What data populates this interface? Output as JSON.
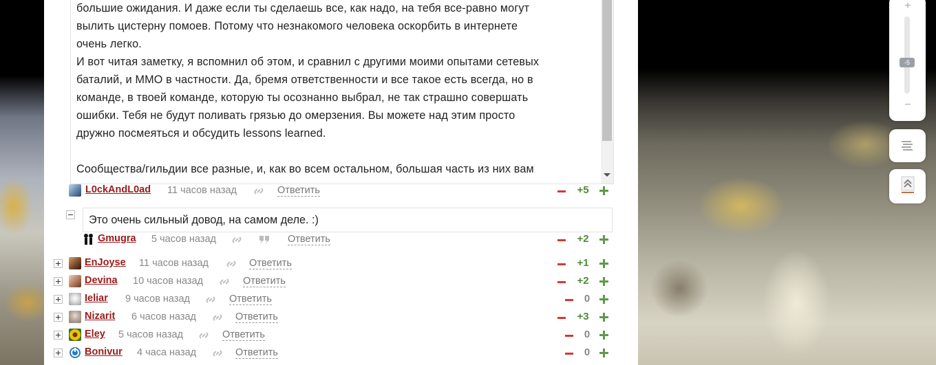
{
  "quote": {
    "lines": [
      "большие ожидания. И даже если ты сделаешь все, как надо, на тебя все-равно могут",
      "вылить цистерну помоев. Потому что незнакомого человека оскорбить в интернете",
      "очень легко.",
      "И вот читая заметку, я вспомнил об этом, и сравнил с другими моими опытами сетевых",
      "баталий, и ММО в частности. Да, бремя ответственности и все такое есть всегда, но в",
      "команде, в твоей команде, которую ты осознанно выбрал, не так страшно совершать",
      "ошибки. Тебя не будут поливать грязью до омерзения. Вы можете над этим просто",
      "дружно посмеяться и обсудить lessons learned.",
      "",
      "Сообщества/гильдии все разные, и, как во всем остальном, большая часть из них вам"
    ]
  },
  "comments": [
    {
      "author": "L0ckAndL0ad",
      "time": "11 часов назад",
      "reply": "Ответить",
      "score": "+5",
      "avatar_color": "#5a7fa6"
    },
    {
      "author": "Gmugra",
      "time": "5 часов назад",
      "reply": "Ответить",
      "score": "+2",
      "avatar_color": "#222222"
    },
    {
      "author": "EnJoyse",
      "time": "11 часов назад",
      "reply": "Ответить",
      "score": "+1",
      "avatar_color": "#7a4a2a"
    },
    {
      "author": "Devina",
      "time": "10 часов назад",
      "reply": "Ответить",
      "score": "+2",
      "avatar_color": "#b07a5a"
    },
    {
      "author": "Ieliar",
      "time": "9 часов назад",
      "reply": "Ответить",
      "score": "0",
      "avatar_color": "#9a9a9a"
    },
    {
      "author": "Nizarit",
      "time": "6 часов назад",
      "reply": "Ответить",
      "score": "+3",
      "avatar_color": "#8a7a70"
    },
    {
      "author": "Eley",
      "time": "5 часов назад",
      "reply": "Ответить",
      "score": "0",
      "avatar_color": "#e8b400"
    },
    {
      "author": "Bonivur",
      "time": "4 часа назад",
      "reply": "Ответить",
      "score": "0",
      "avatar_color": "#2a7ac0"
    }
  ],
  "reply_text": "Это очень сильный довод, на самом деле. :)",
  "zoom": {
    "plus": "+",
    "minus": "−",
    "level": "-5"
  },
  "colors": {
    "author": "#9a1b1b",
    "vote_minus": "#d03a35",
    "vote_plus": "#5d9a4a"
  },
  "icons": [
    "link-icon",
    "quote-icon",
    "menu-lines-icon",
    "scroll-top-icon"
  ]
}
